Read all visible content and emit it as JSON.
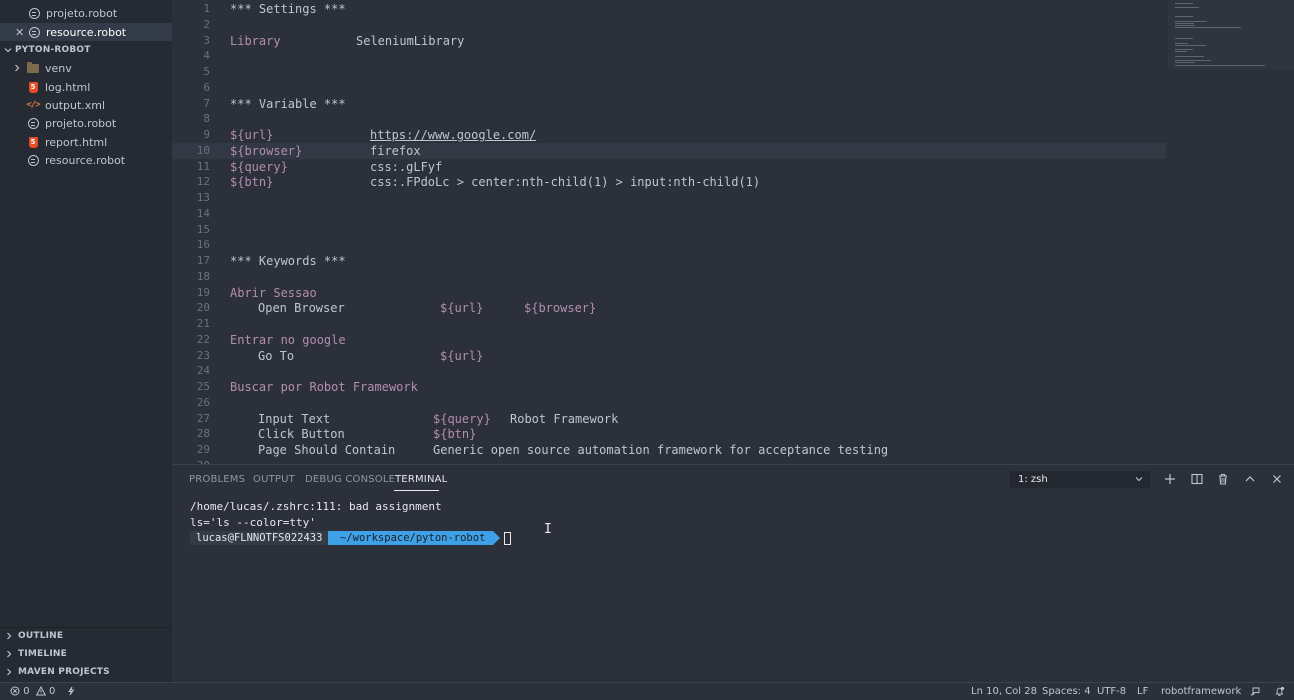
{
  "sidebar": {
    "open_editors": [
      {
        "label": "projeto.robot",
        "icon": "robot-file-icon",
        "active": false
      },
      {
        "label": "resource.robot",
        "icon": "robot-file-icon",
        "active": true
      }
    ],
    "project_header": "PYTON-ROBOT",
    "files": [
      {
        "label": "venv",
        "icon": "folder-icon",
        "is_folder": true
      },
      {
        "label": "log.html",
        "icon": "html5-icon"
      },
      {
        "label": "output.xml",
        "icon": "xml-icon"
      },
      {
        "label": "projeto.robot",
        "icon": "robot-file-icon"
      },
      {
        "label": "report.html",
        "icon": "html5-icon"
      },
      {
        "label": "resource.robot",
        "icon": "robot-file-icon"
      }
    ],
    "bottom_sections": [
      "OUTLINE",
      "TIMELINE",
      "MAVEN PROJECTS"
    ]
  },
  "editor": {
    "current_line": 10,
    "lines": [
      {
        "n": "1",
        "text": "*** Settings ***"
      },
      {
        "n": "2",
        "text": ""
      },
      {
        "n": "3",
        "a": "Library",
        "b": "SeleniumLibrary"
      },
      {
        "n": "4",
        "text": ""
      },
      {
        "n": "5",
        "text": ""
      },
      {
        "n": "6",
        "text": ""
      },
      {
        "n": "7",
        "text": "*** Variable ***"
      },
      {
        "n": "8",
        "text": ""
      },
      {
        "n": "9",
        "var": "${url}",
        "val": "https://www.google.com/"
      },
      {
        "n": "10",
        "var": "${browser}",
        "val": "firefox"
      },
      {
        "n": "11",
        "var": "${query}",
        "val": "css:.gLFyf"
      },
      {
        "n": "12",
        "var": "${btn}",
        "val": "css:.FPdoLc > center:nth-child(1) > input:nth-child(1)"
      },
      {
        "n": "13",
        "text": ""
      },
      {
        "n": "14",
        "text": ""
      },
      {
        "n": "15",
        "text": ""
      },
      {
        "n": "16",
        "text": ""
      },
      {
        "n": "17",
        "text": "*** Keywords ***"
      },
      {
        "n": "18",
        "text": ""
      },
      {
        "n": "19",
        "kw": "Abrir Sessao"
      },
      {
        "n": "20",
        "step": "Open Browser",
        "args": [
          "${url}",
          "${browser}"
        ]
      },
      {
        "n": "21",
        "text": ""
      },
      {
        "n": "22",
        "kw": "Entrar no google"
      },
      {
        "n": "23",
        "step": "Go To",
        "args": [
          "${url}"
        ]
      },
      {
        "n": "24",
        "text": ""
      },
      {
        "n": "25",
        "kw": "Buscar por Robot Framework"
      },
      {
        "n": "26",
        "text": ""
      },
      {
        "n": "27",
        "step": "Input Text",
        "args": [
          "${query}"
        ],
        "plain": "Robot Framework"
      },
      {
        "n": "28",
        "step": "Click Button",
        "args": [
          "${btn}"
        ]
      },
      {
        "n": "29",
        "step": "Page Should Contain",
        "plain": "Generic open source automation framework for acceptance testing"
      },
      {
        "n": "30",
        "text": ""
      }
    ]
  },
  "panel": {
    "tabs": [
      "PROBLEMS",
      "OUTPUT",
      "DEBUG CONSOLE",
      "TERMINAL"
    ],
    "active_tab": "TERMINAL",
    "terminal_select": "1: zsh",
    "terminal": {
      "line1": "/home/lucas/.zshrc:111: bad assignment",
      "line2": "ls='ls --color=tty'",
      "prompt_user": "lucas@FLNNOTFS022433",
      "prompt_path": "~/workspace/pyton-robot"
    }
  },
  "statusbar": {
    "errors": "0",
    "warnings": "0",
    "position": "Ln 10, Col 28",
    "spaces": "Spaces: 4",
    "encoding": "UTF-8",
    "eol": "LF",
    "language": "robotframework"
  },
  "colors": {
    "variable": "#b48ead",
    "accent_prompt": "#3ea0e6",
    "html_icon": "#e44d26",
    "xml_icon": "#e37933"
  }
}
